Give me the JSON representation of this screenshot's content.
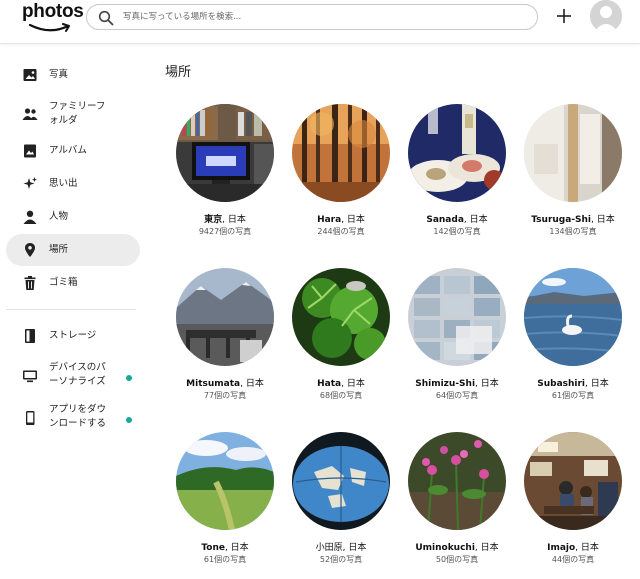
{
  "app": {
    "logo_text": "photos"
  },
  "search": {
    "placeholder": "写真に写っている場所を検索..."
  },
  "sidebar": {
    "items": [
      {
        "label": "写真",
        "icon": "photo-icon"
      },
      {
        "label": "ファミリーフォルダ",
        "line1": "ファミリーフ",
        "line2": "ォルダ",
        "icon": "family-icon"
      },
      {
        "label": "アルバム",
        "icon": "album-icon"
      },
      {
        "label": "思い出",
        "icon": "memories-icon"
      },
      {
        "label": "人物",
        "icon": "person-icon"
      },
      {
        "label": "場所",
        "icon": "location-pin-icon",
        "active": true
      },
      {
        "label": "ゴミ箱",
        "icon": "trash-icon"
      },
      {
        "label": "ストレージ",
        "icon": "storage-icon"
      },
      {
        "label": "デバイスのパーソナライズ",
        "line1": "デバイスのパ",
        "line2": "ーソナライズ",
        "icon": "device-icon",
        "badge_color": "#16a99a"
      },
      {
        "label": "アプリをダウンロードする",
        "line1": "アプリをダウ",
        "line2": "ンロードする",
        "icon": "phone-icon",
        "badge_color": "#16a99a"
      }
    ]
  },
  "main": {
    "title": "場所",
    "places": [
      {
        "name": "東京",
        "suffix": ", 日本",
        "count": "9427個の写真"
      },
      {
        "name": "Hara",
        "suffix": ", 日本",
        "count": "244個の写真"
      },
      {
        "name": "Sanada",
        "suffix": ", 日本",
        "count": "142個の写真"
      },
      {
        "name": "Tsuruga-Shi",
        "suffix": ", 日本",
        "count": "134個の写真"
      },
      {
        "name": "Mitsumata",
        "suffix": ", 日本",
        "count": "77個の写真"
      },
      {
        "name": "Hata",
        "suffix": ", 日本",
        "count": "68個の写真"
      },
      {
        "name": "Shimizu-Shi",
        "suffix": ", 日本",
        "count": "64個の写真"
      },
      {
        "name": "Subashiri",
        "suffix": ", 日本",
        "count": "61個の写真"
      },
      {
        "name": "Tone",
        "suffix": ", 日本",
        "count": "61個の写真"
      },
      {
        "name": "小田原",
        "suffix": ", 日本",
        "count": "52個の写真"
      },
      {
        "name": "Uminokuchi",
        "suffix": ", 日本",
        "count": "50個の写真"
      },
      {
        "name": "Imajo",
        "suffix": ", 日本",
        "count": "44個の写真"
      }
    ]
  },
  "colors": {
    "accent_dot": "#16a99a",
    "active_bg": "#ececec",
    "logo_smile": "#ff9900"
  }
}
